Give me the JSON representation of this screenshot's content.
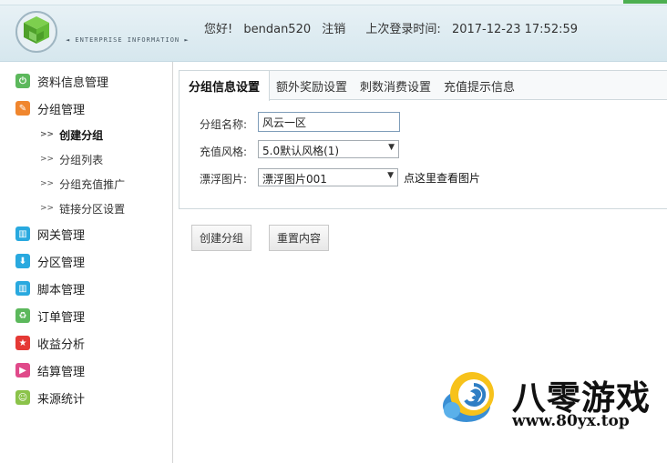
{
  "header": {
    "logo_subtitle": "◄ ENTERPRISE INFORMATION ►",
    "greeting": "您好!",
    "username": "bendan520",
    "logout": "注销",
    "last_login_label": "上次登录时间:",
    "last_login_time": "2017-12-23 17:52:59"
  },
  "sidebar": {
    "items": [
      {
        "label": "资料信息管理",
        "icon": "power-icon",
        "color": "#5cb85c"
      },
      {
        "label": "分组管理",
        "icon": "pencil-icon",
        "color": "#f0862e"
      },
      {
        "label": "网关管理",
        "icon": "grid-icon",
        "color": "#29a9df"
      },
      {
        "label": "分区管理",
        "icon": "download-icon",
        "color": "#29a9df"
      },
      {
        "label": "脚本管理",
        "icon": "grid-icon",
        "color": "#29a9df"
      },
      {
        "label": "订单管理",
        "icon": "recycle-icon",
        "color": "#5cb85c"
      },
      {
        "label": "收益分析",
        "icon": "star-icon",
        "color": "#e53935"
      },
      {
        "label": "结算管理",
        "icon": "play-icon",
        "color": "#e04a8a"
      },
      {
        "label": "来源统计",
        "icon": "smile-icon",
        "color": "#8bc34a"
      }
    ],
    "subitems": [
      {
        "label": "创建分组",
        "active": true
      },
      {
        "label": "分组列表",
        "active": false
      },
      {
        "label": "分组充值推广",
        "active": false
      },
      {
        "label": "链接分区设置",
        "active": false
      }
    ],
    "sub_arrow": ">>"
  },
  "tabs": [
    "分组信息设置",
    "额外奖励设置",
    "刺数消费设置",
    "充值提示信息"
  ],
  "form": {
    "name_label": "分组名称:",
    "name_value": "风云一区",
    "style_label": "充值风格:",
    "style_value": "5.0默认风格(1)",
    "image_label": "漂浮图片:",
    "image_value": "漂浮图片001",
    "view_image_link": "点这里查看图片"
  },
  "buttons": {
    "create": "创建分组",
    "reset": "重置内容"
  },
  "watermark": {
    "title": "八零游戏",
    "url": "www.80yx.top"
  }
}
